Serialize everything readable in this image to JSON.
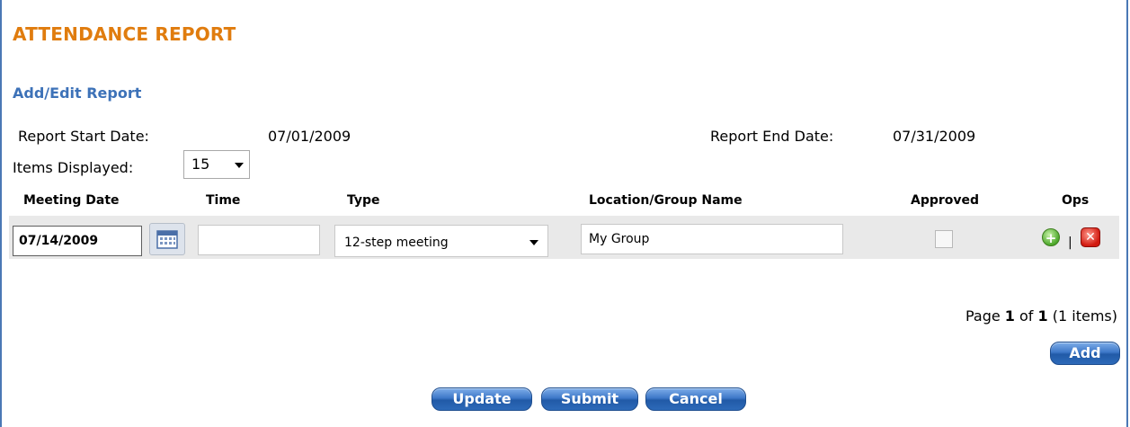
{
  "page": {
    "title": "ATTENDANCE REPORT",
    "section_title": "Add/Edit Report"
  },
  "report": {
    "start_label": "Report Start Date:",
    "start_value": "07/01/2009",
    "end_label": "Report End Date:",
    "end_value": "07/31/2009",
    "items_label": "Items Displayed:",
    "items_value": "15"
  },
  "grid": {
    "headers": [
      "Meeting Date",
      "Time",
      "Type",
      "Location/Group Name",
      "Approved",
      "Ops"
    ],
    "rows": [
      {
        "meeting_date": "07/14/2009",
        "time": "",
        "type": "12-step meeting",
        "location": "My Group",
        "approved": false
      }
    ]
  },
  "pager": {
    "prefix": "Page",
    "page": "1",
    "of": "of",
    "total": "1",
    "items": "(1 items)"
  },
  "buttons": {
    "add": "Add",
    "update": "Update",
    "submit": "Submit",
    "cancel": "Cancel"
  },
  "ops": {
    "separator": "|",
    "add_icon": "add-circle-icon",
    "delete_icon": "delete-x-icon"
  },
  "colors": {
    "title": "#e07c0e",
    "section": "#3d72b8",
    "button": "#2d6ab9",
    "row_bg": "#e9e9e9"
  }
}
